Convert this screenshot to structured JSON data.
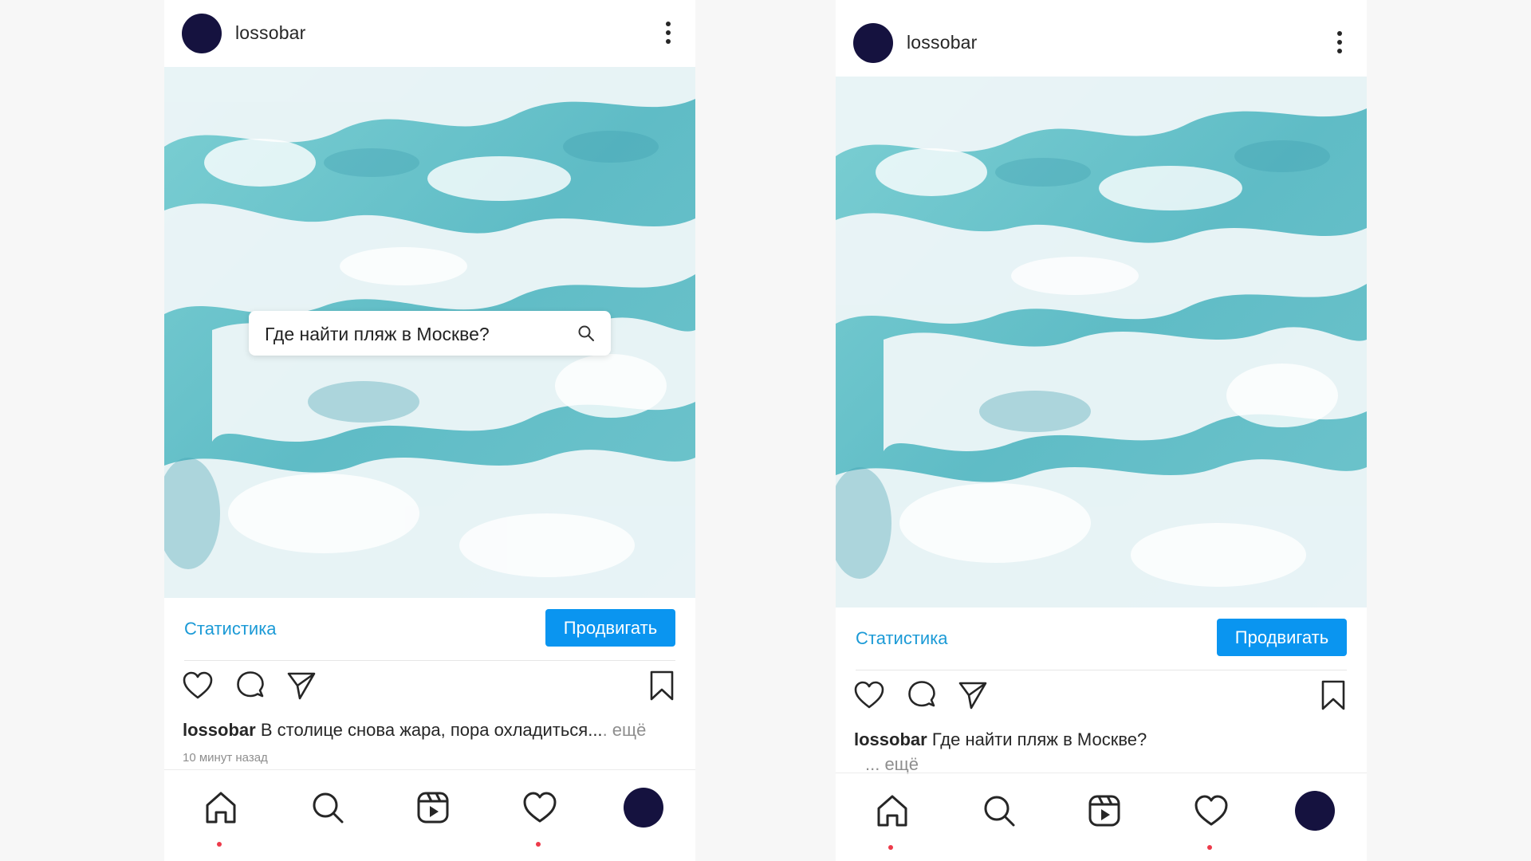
{
  "left_post": {
    "username": "lossobar",
    "search_query": "Где найти пляж в Москве?",
    "stats_link": "Статистика",
    "promote_button": "Продвигать",
    "caption_user": "lossobar",
    "caption_text": "В столице снова жара, пора охладиться...",
    "caption_more": ". ещё",
    "timestamp": "10 минут назад"
  },
  "right_post": {
    "username": "lossobar",
    "stats_link": "Статистика",
    "promote_button": "Продвигать",
    "caption_user": "lossobar",
    "caption_text": "Где найти пляж в Москве?",
    "caption_more": "... ещё"
  },
  "icons": {
    "header_menu": "more-vertical-icon",
    "actions": [
      "heart-icon",
      "comment-icon",
      "send-icon",
      "bookmark-icon"
    ],
    "nav": [
      "home-icon",
      "search-icon",
      "reels-icon",
      "heart-icon",
      "profile-avatar"
    ]
  },
  "colors": {
    "avatar": "#15123f",
    "link": "#1b9ad6",
    "button": "#0a95f0",
    "notification_dot": "#ed3a4a",
    "water_light": "#e9f3f7",
    "water_teal": "#55b8c2"
  }
}
